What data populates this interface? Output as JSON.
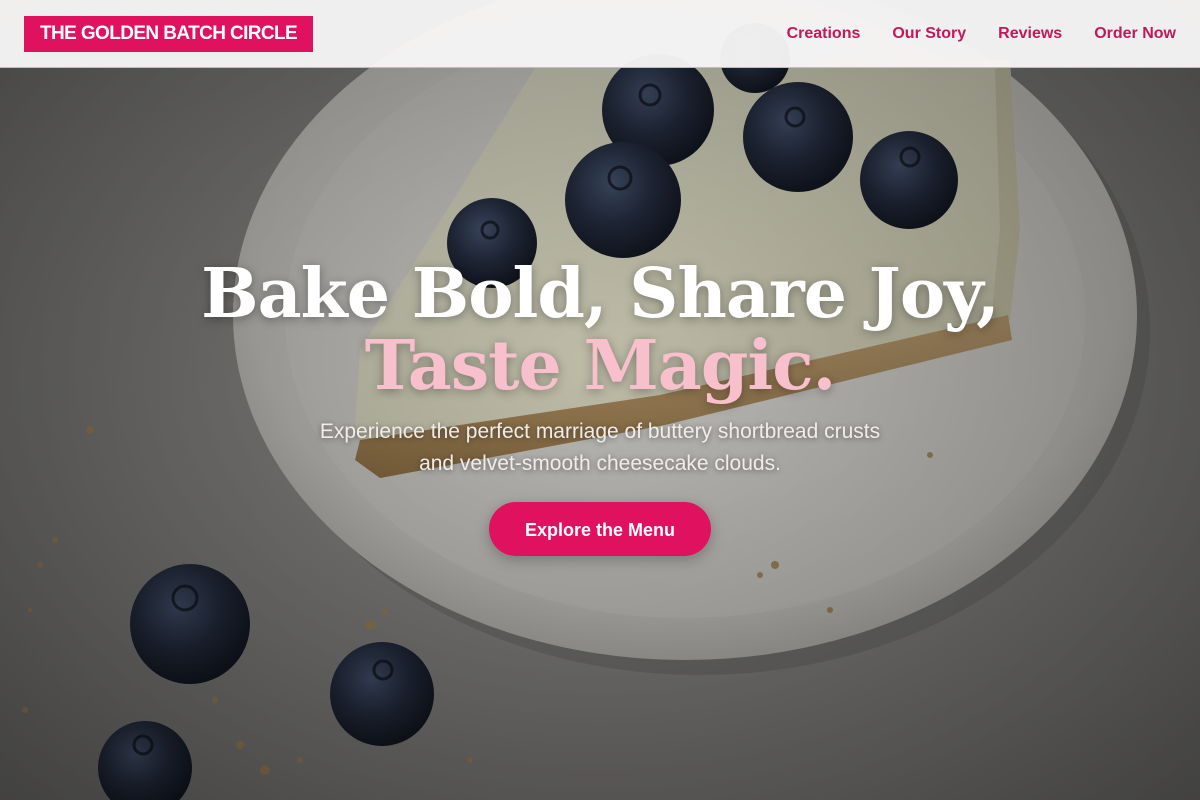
{
  "header": {
    "logo_text": "THE GOLDEN BATCH CIRCLE",
    "nav": [
      {
        "label": "Creations"
      },
      {
        "label": "Our Story"
      },
      {
        "label": "Reviews"
      },
      {
        "label": "Order Now"
      }
    ]
  },
  "hero": {
    "headline_line1": "Bake Bold, Share Joy,",
    "headline_line2": "Taste Magic.",
    "subtitle_line1": "Experience the perfect marriage of buttery shortbread crusts",
    "subtitle_line2": "and velvet-smooth cheesecake clouds.",
    "cta_label": "Explore the Menu",
    "background_description": "cheesecake-slice-with-blueberries-photo"
  },
  "colors": {
    "brand_pink": "#e0115f",
    "nav_text": "#c2185b",
    "headline_accent": "#f8bfcd",
    "headline_white": "#ffffff",
    "header_bg": "#f7f6f6"
  }
}
